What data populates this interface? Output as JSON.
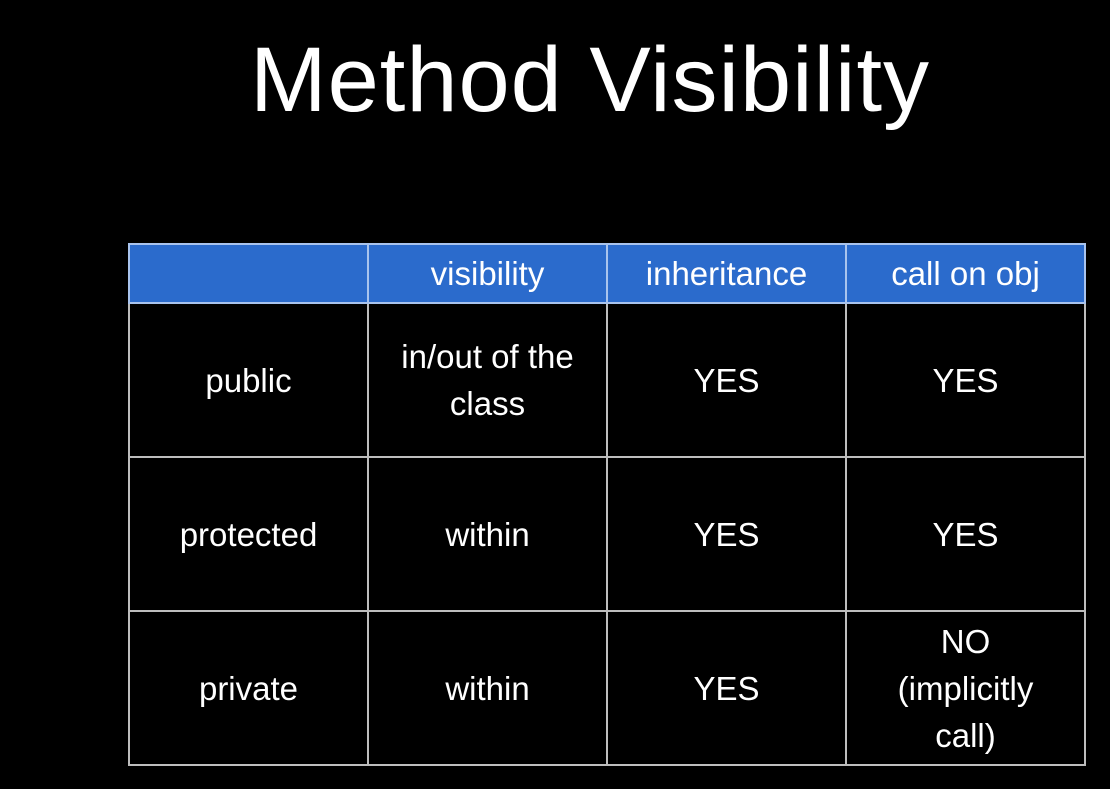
{
  "title": "Method Visibility",
  "table": {
    "headers": [
      "",
      "visibility",
      "inheritance",
      "call on obj"
    ],
    "rows": [
      [
        "public",
        "in/out of the class",
        "YES",
        "YES"
      ],
      [
        "protected",
        "within",
        "YES",
        "YES"
      ],
      [
        "private",
        "within",
        "YES",
        "NO (implicitly call)"
      ]
    ]
  },
  "colors": {
    "header_bg": "#2b6bcc",
    "background": "#000000"
  }
}
